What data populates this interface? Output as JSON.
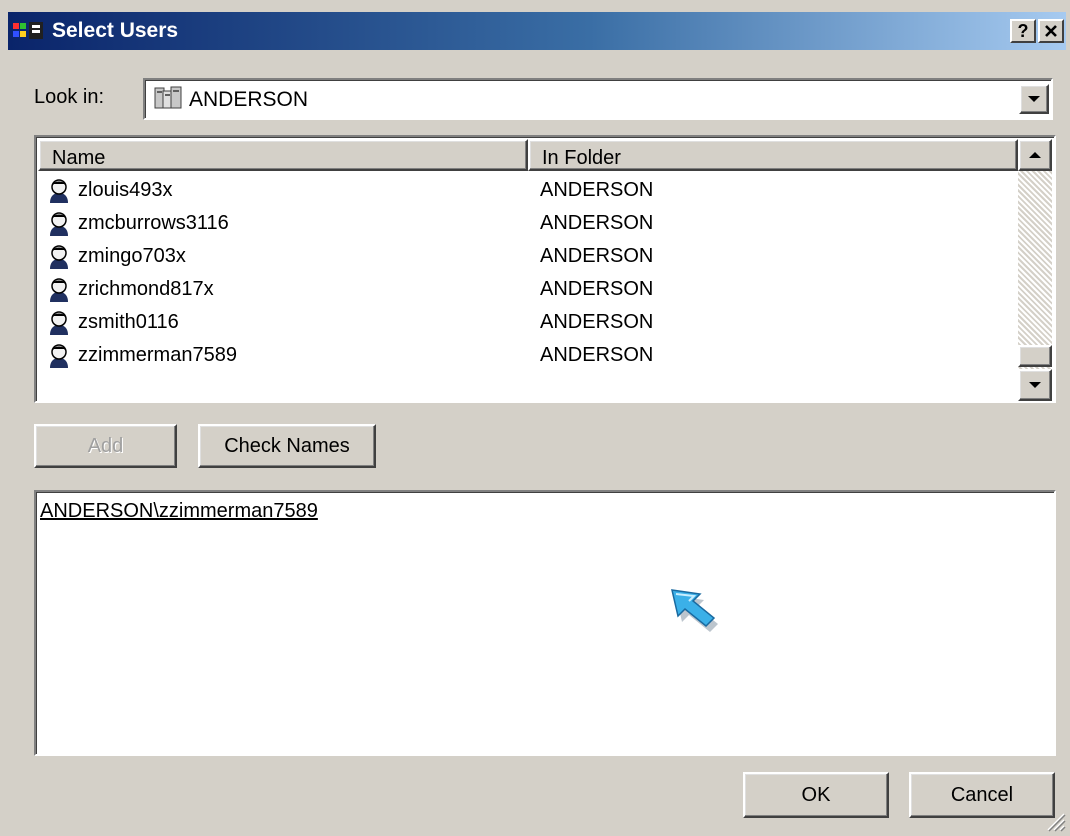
{
  "window": {
    "title": "Select Users",
    "help_button": "?",
    "close_button": "x"
  },
  "look_in": {
    "label": "Look in:",
    "value": "ANDERSON"
  },
  "list": {
    "columns": [
      "Name",
      "In Folder"
    ],
    "rows": [
      {
        "name": "zlouis493x",
        "folder": "ANDERSON"
      },
      {
        "name": "zmcburrows3116",
        "folder": "ANDERSON"
      },
      {
        "name": "zmingo703x",
        "folder": "ANDERSON"
      },
      {
        "name": "zrichmond817x",
        "folder": "ANDERSON"
      },
      {
        "name": "zsmith0116",
        "folder": "ANDERSON"
      },
      {
        "name": "zzimmerman7589",
        "folder": "ANDERSON"
      }
    ]
  },
  "buttons": {
    "add": "Add",
    "check_names": "Check Names",
    "ok": "OK",
    "cancel": "Cancel"
  },
  "selected_names": {
    "text": "ANDERSON\\zzimmerman7589"
  },
  "colors": {
    "title_start": "#0a246a",
    "title_end": "#a6caf0",
    "face": "#d4d0c8"
  },
  "icons": {
    "title": "app-icon",
    "look_in": "computer-domain-icon",
    "row": "user-icon",
    "cursor": "mouse-pointer-icon"
  }
}
